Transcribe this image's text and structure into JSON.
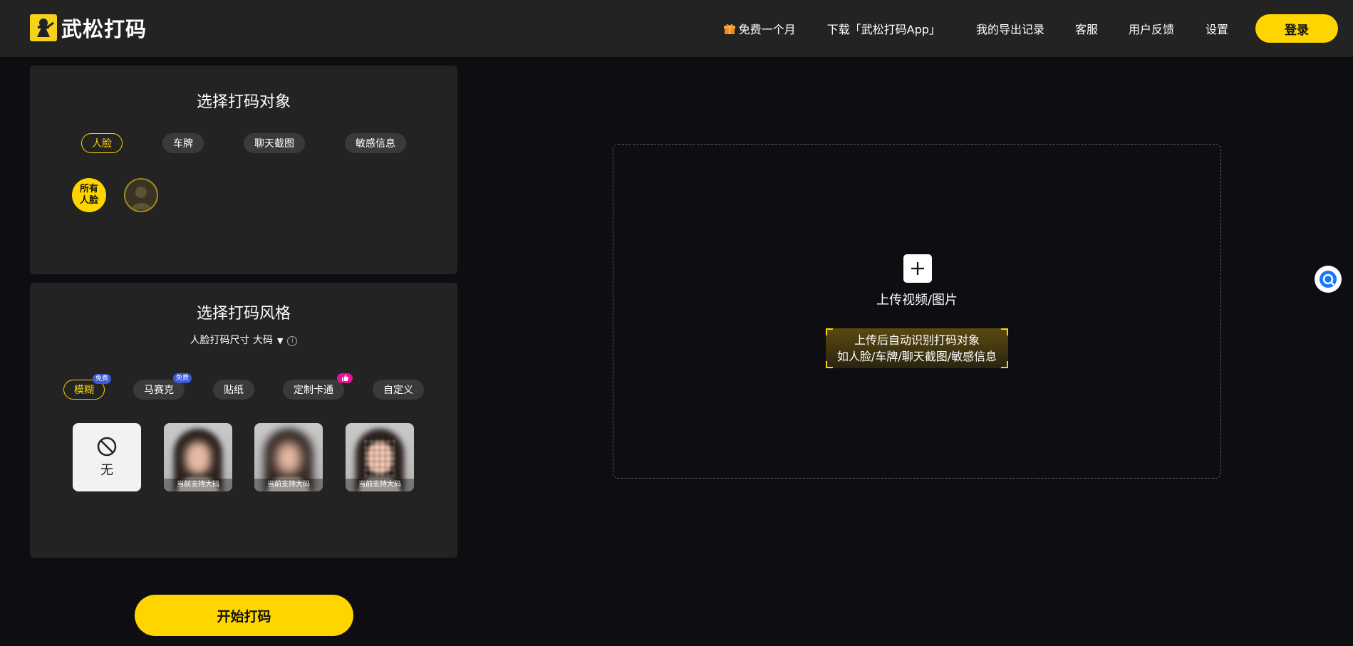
{
  "header": {
    "logo_text": "武松打码",
    "nav": {
      "free_month": "免费一个月",
      "download": "下载「武松打码App」",
      "export_records": "我的导出记录",
      "customer_service": "客服",
      "feedback": "用户反馈",
      "settings": "设置"
    },
    "login_label": "登录"
  },
  "target_panel": {
    "title": "选择打码对象",
    "tabs": [
      "人脸",
      "车牌",
      "聊天截图",
      "敏感信息"
    ],
    "active_tab": "人脸",
    "all_faces_line1": "所有",
    "all_faces_line2": "人脸"
  },
  "style_panel": {
    "title": "选择打码风格",
    "size_selector": "人脸打码尺寸 大码",
    "info_icon": "i",
    "tabs": [
      {
        "label": "模糊",
        "badge": "免费"
      },
      {
        "label": "马赛克",
        "badge": "免费"
      },
      {
        "label": "贴纸",
        "badge": ""
      },
      {
        "label": "定制卡通",
        "badge": "thumbs-up-icon"
      },
      {
        "label": "自定义",
        "badge": ""
      }
    ],
    "active_tab": "模糊",
    "cards": {
      "none_label": "无",
      "captions": [
        "当前支持大码",
        "当前支持大码",
        "当前支持大码"
      ]
    }
  },
  "start_button": "开始打码",
  "upload": {
    "label": "上传视频/图片",
    "hint_line1": "上传后自动识别打码对象",
    "hint_line2": "如人脸/车牌/聊天截图/敏感信息"
  },
  "colors": {
    "accent": "#ffd500",
    "background": "#0e0e12",
    "panel": "#232323",
    "badge_blue": "#3b5bdb",
    "badge_pink": "#e6119c"
  }
}
